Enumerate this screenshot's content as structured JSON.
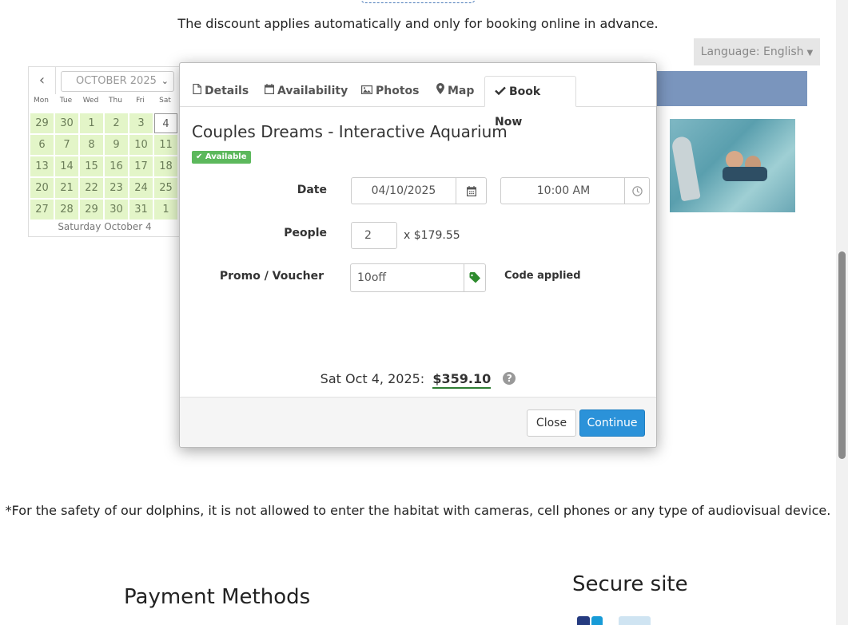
{
  "page": {
    "discount_note": "The discount applies automatically and only for booking online in advance.",
    "language_label": "Language: English",
    "safety_note": "*For the safety of our dolphins, it is not allowed to enter the habitat with cameras, cell phones or any type of audiovisual device.",
    "payment_methods_title": "Payment Methods",
    "secure_site_title": "Secure site"
  },
  "calendar": {
    "month_select": "OCTOBER 2025",
    "weekdays": [
      "Mon",
      "Tue",
      "Wed",
      "Thu",
      "Fri",
      "Sat"
    ],
    "days": [
      "29",
      "30",
      "1",
      "2",
      "3",
      "4",
      "6",
      "7",
      "8",
      "9",
      "10",
      "11",
      "13",
      "14",
      "15",
      "16",
      "17",
      "18",
      "20",
      "21",
      "22",
      "23",
      "24",
      "25",
      "27",
      "28",
      "29",
      "30",
      "31",
      "1"
    ],
    "selected_day": "4",
    "selected_label": "Saturday October 4"
  },
  "modal": {
    "tabs": [
      {
        "label": "Details",
        "icon": "file-icon"
      },
      {
        "label": "Availability",
        "icon": "calendar-icon"
      },
      {
        "label": "Photos",
        "icon": "image-icon"
      },
      {
        "label": "Map",
        "icon": "map-marker-icon"
      },
      {
        "label": "Book Now",
        "icon": "check-icon",
        "active": true
      }
    ],
    "title": "Couples Dreams - Interactive Aquarium",
    "availability_badge": "Available",
    "date_label": "Date",
    "date_value": "04/10/2025",
    "time_value": "10:00 AM",
    "people_label": "People",
    "people_value": "2",
    "price_each": "x $179.55",
    "promo_label": "Promo / Voucher",
    "promo_value": "10off",
    "promo_status": "Code applied",
    "total_date": "Sat Oct 4, 2025:",
    "total_amount": "$359.10",
    "help_glyph": "?",
    "close_label": "Close",
    "continue_label": "Continue"
  },
  "colors": {
    "primary_button": "#2b92d9",
    "available_badge": "#5cb85c",
    "calendar_available": "#e3f5c8",
    "promo_tag_icon": "#2e8b2e"
  }
}
